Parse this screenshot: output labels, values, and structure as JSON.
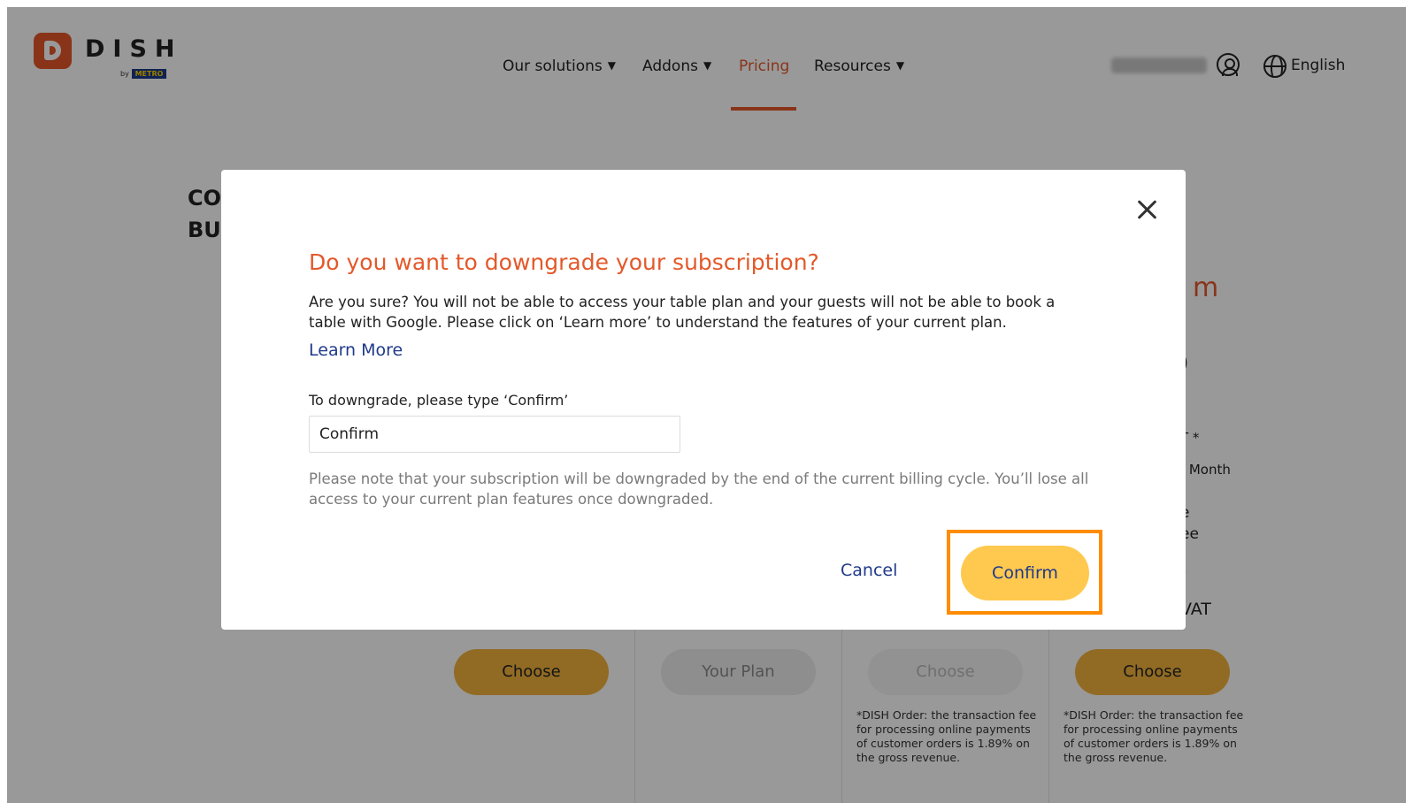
{
  "brand": {
    "name": "DISH",
    "by": "by",
    "sub": "METRO"
  },
  "nav": {
    "items": [
      {
        "label": "Our solutions",
        "caret": "▼"
      },
      {
        "label": "Addons",
        "caret": "▼"
      },
      {
        "label": "Pricing",
        "caret": ""
      },
      {
        "label": "Resources",
        "caret": "▼"
      }
    ],
    "active": "Pricing",
    "language": "English"
  },
  "background": {
    "heading_line1": "CO",
    "heading_line2": "BUI",
    "partial_plan_name": "m",
    "partial_price": ")",
    "partial_vat": "T *",
    "partial_month": "/ Month",
    "partial_line1": "e",
    "partial_line2": "ee",
    "partial_price2": ")",
    "partial_vat2": "VAT",
    "buttons": [
      "Choose",
      "Your Plan",
      "Choose",
      "Choose"
    ],
    "footnote": "*DISH Order: the transaction fee for processing online payments of customer orders is 1.89% on the gross revenue."
  },
  "modal": {
    "title": "Do you want to downgrade your subscription?",
    "body": "Are you sure? You will not be able to access your table plan and your guests will not be able to book a table with Google. Please click on ‘Learn more’ to understand the features of your current plan.",
    "learn_more": "Learn More",
    "input_label": "To downgrade, please type ‘Confirm’",
    "input_value": "Confirm",
    "note": "Please note that your subscription will be downgraded by the end of the current billing cycle. You’ll lose all access to your current plan features once downgraded.",
    "cancel_label": "Cancel",
    "confirm_label": "Confirm"
  },
  "colors": {
    "accent": "#e4582a",
    "link": "#1f3a8a",
    "confirm": "#ffc94f",
    "highlight": "#ff8c00"
  }
}
